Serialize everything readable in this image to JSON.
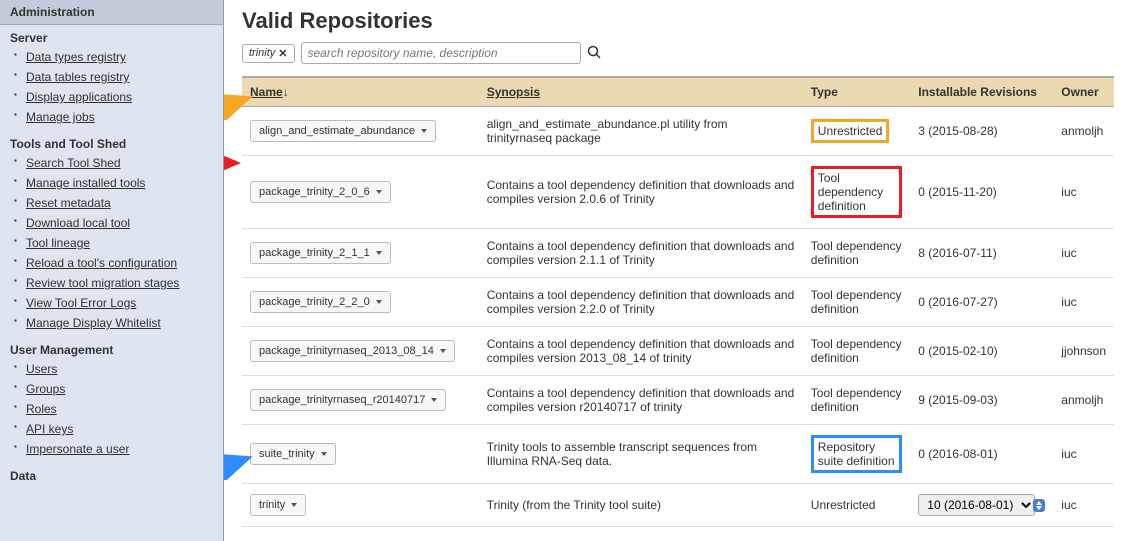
{
  "sidebar": {
    "header": "Administration",
    "sections": [
      {
        "title": "Server",
        "items": [
          "Data types registry",
          "Data tables registry",
          "Display applications",
          "Manage jobs"
        ]
      },
      {
        "title": "Tools and Tool Shed",
        "items": [
          "Search Tool Shed",
          "Manage installed tools",
          "Reset metadata",
          "Download local tool",
          "Tool lineage",
          "Reload a tool's configuration",
          "Review tool migration stages",
          "View Tool Error Logs",
          "Manage Display Whitelist"
        ]
      },
      {
        "title": "User Management",
        "items": [
          "Users",
          "Groups",
          "Roles",
          "API keys",
          "Impersonate a user"
        ]
      },
      {
        "title": "Data",
        "items": []
      }
    ]
  },
  "main": {
    "title": "Valid Repositories",
    "filter_tag": "trinity",
    "search_placeholder": "search repository name, description",
    "columns": {
      "name": "Name",
      "sort": "↓",
      "synopsis": "Synopsis",
      "type": "Type",
      "revisions": "Installable Revisions",
      "owner": "Owner"
    },
    "rows": [
      {
        "name": "align_and_estimate_abundance",
        "synopsis": "align_and_estimate_abundance.pl utility from trinityrnaseq package",
        "type": "Unrestricted",
        "type_hl": "orange",
        "revisions": "3 (2015-08-28)",
        "owner": "anmoljh",
        "arrow": "orange"
      },
      {
        "name": "package_trinity_2_0_6",
        "synopsis": "Contains a tool dependency definition that downloads and compiles version 2.0.6 of Trinity",
        "type": "Tool dependency definition",
        "type_hl": "red",
        "revisions": "0 (2015-11-20)",
        "owner": "iuc",
        "arrow": "red"
      },
      {
        "name": "package_trinity_2_1_1",
        "synopsis": "Contains a tool dependency definition that downloads and compiles version 2.1.1 of Trinity",
        "type": "Tool dependency definition",
        "type_hl": null,
        "revisions": "8 (2016-07-11)",
        "owner": "iuc"
      },
      {
        "name": "package_trinity_2_2_0",
        "synopsis": "Contains a tool dependency definition that downloads and compiles version 2.2.0 of Trinity",
        "type": "Tool dependency definition",
        "type_hl": null,
        "revisions": "0 (2016-07-27)",
        "owner": "iuc"
      },
      {
        "name": "package_trinityrnaseq_2013_08_14",
        "synopsis": "Contains a tool dependency definition that downloads and compiles version 2013_08_14 of trinity",
        "type": "Tool dependency definition",
        "type_hl": null,
        "revisions": "0 (2015-02-10)",
        "owner": "jjohnson"
      },
      {
        "name": "package_trinityrnaseq_r20140717",
        "synopsis": "Contains a tool dependency definition that downloads and compiles version r20140717 of trinity",
        "type": "Tool dependency definition",
        "type_hl": null,
        "revisions": "9 (2015-09-03)",
        "owner": "anmoljh"
      },
      {
        "name": "suite_trinity",
        "synopsis": "Trinity tools to assemble transcript sequences from Illumina RNA-Seq data.",
        "type": "Repository suite definition",
        "type_hl": "blue",
        "revisions": "0 (2016-08-01)",
        "owner": "iuc",
        "arrow": "blue"
      },
      {
        "name": "trinity",
        "synopsis": "Trinity (from the Trinity tool suite)",
        "type": "Unrestricted",
        "type_hl": null,
        "revisions": "10 (2016-08-01)",
        "revisions_select": true,
        "owner": "iuc"
      }
    ]
  }
}
